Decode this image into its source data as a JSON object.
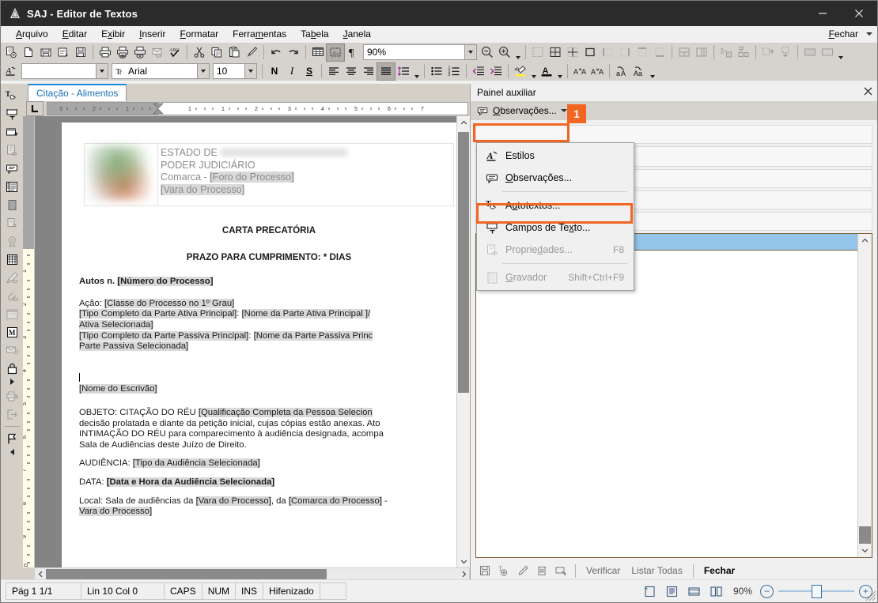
{
  "window": {
    "title": "SAJ - Editor de Textos",
    "icon": "app-icon",
    "minimize": "–",
    "close": "✕"
  },
  "menubar": {
    "items": [
      {
        "label": "Arquivo",
        "accel": "A"
      },
      {
        "label": "Editar",
        "accel": "E"
      },
      {
        "label": "Exibir",
        "accel": "x"
      },
      {
        "label": "Inserir",
        "accel": "I"
      },
      {
        "label": "Formatar",
        "accel": "F"
      },
      {
        "label": "Ferramentas",
        "accel": "m"
      },
      {
        "label": "Tabela",
        "accel": "b"
      },
      {
        "label": "Janela",
        "accel": "J"
      }
    ],
    "close_label": "Fechar"
  },
  "toolbar": {
    "zoom_value": "90%",
    "style_value": "",
    "font_value": "Arial",
    "size_value": "10",
    "bold_label": "N",
    "italic_label": "I",
    "underline_label": "S"
  },
  "tabs": {
    "active": "Citação - Alimentos"
  },
  "ruler": {
    "marks_left": [
      "3",
      "2",
      "1"
    ],
    "marks_right": [
      "1",
      "1",
      "2",
      "3",
      "4",
      "5",
      "6",
      "7"
    ]
  },
  "document": {
    "header": {
      "line1_prefix": "ESTADO DE",
      "line1_redacted": "",
      "line2": "PODER JUDICIÁRIO",
      "line3_prefix": "Comarca - ",
      "line3_field": "[Foro do Processo]",
      "line4_field": "[Vara do Processo]"
    },
    "title": "CARTA PRECATÓRIA",
    "subtitle": "PRAZO PARA CUMPRIMENTO: * DIAS",
    "autos_label": "Autos n. ",
    "autos_field": "[Número do Processo]",
    "acao_label": "Ação: ",
    "acao_field": "[Classe do Processo no 1º Grau]",
    "parte_ativa_tipo": "[Tipo Completo da Parte Ativa Principal]",
    "parte_ativa_nome": "[Nome da Parte Ativa Principal ]/",
    "parte_ativa_sel": "Ativa Selecionada]",
    "parte_passiva_tipo": "[Tipo Completo da Parte Passiva Principal]",
    "parte_passiva_nome": "[Nome da Parte Passiva Princ",
    "parte_passiva_sel": "Parte Passiva Selecionada]",
    "escrivao_field": "[Nome do Escrivão]",
    "objeto_label": "OBJETO: CITAÇÃO DO RÉU ",
    "objeto_field": "[Qualificação Completa da Pessoa Selecion",
    "objeto_line2": "decisão prolatada e diante da petição inicial, cujas cópias estão anexas. Ato",
    "objeto_line3": "INTIMAÇÃO DO RÉU para comparecimento à audiência designada, acompa",
    "objeto_line4": "Sala de Audiências deste Juízo de Direito.",
    "audiencia_label": "AUDIÊNCIA: ",
    "audiencia_field": "[Tipo da Audiência Selecionada]",
    "data_label": "DATA: ",
    "data_field": "[Data e Hora da Audiência Selecionada]",
    "local_prefix": "Local: Sala de audiências da ",
    "local_vara": "[Vara do Processo]",
    "local_mid": ", da ",
    "local_comarca": "[Comarca do Processo]",
    "local_suffix": " -",
    "local_line2": "Vara do Processo]"
  },
  "panel": {
    "title": "Painel auxiliar",
    "close_icon": "✕",
    "menu_button": {
      "label": "Observações...",
      "accel": "O",
      "icon": "comment-icon"
    },
    "footer": {
      "buttons": [
        "save-icon",
        "add-text-field-icon",
        "edit-pencil-icon",
        "delete-trash-icon",
        "select-field-icon"
      ],
      "links": [
        "Verificar",
        "Listar Todas"
      ],
      "close_label": "Fechar"
    }
  },
  "dropdown": {
    "items": [
      {
        "label": "Estilos",
        "accel": "",
        "icon": "styles-icon",
        "shortcut": "",
        "disabled": false,
        "sep_after": false
      },
      {
        "label": "Observações...",
        "accel": "O",
        "icon": "comment-icon",
        "shortcut": "",
        "disabled": false,
        "sep_after": true
      },
      {
        "label": "Autotextos...",
        "accel": "u",
        "icon": "autotext-icon",
        "shortcut": "",
        "disabled": false,
        "sep_after": false
      },
      {
        "label": "Campos de Texto...",
        "accel": "x",
        "icon": "text-field-icon",
        "shortcut": "",
        "disabled": false,
        "sep_after": false,
        "highlighted": true
      },
      {
        "label": "Propriedades...",
        "accel": "d",
        "icon": "properties-icon",
        "shortcut": "F8",
        "disabled": true,
        "sep_after": true
      },
      {
        "label": "Gravador",
        "accel": "G",
        "icon": "recorder-icon",
        "shortcut": "Shift+Ctrl+F9",
        "disabled": true,
        "sep_after": false
      }
    ]
  },
  "annotations": {
    "badge_1": "1"
  },
  "statusbar": {
    "cells": [
      {
        "name": "page-cell",
        "text": "Pág 1   1/1"
      },
      {
        "name": "line-col-cell",
        "text": "Lin 10  Col 0"
      },
      {
        "name": "caps-cell",
        "text": "CAPS"
      },
      {
        "name": "num-cell",
        "text": "NUM"
      },
      {
        "name": "ins-cell",
        "text": "INS"
      },
      {
        "name": "hyphen-cell",
        "text": "Hifenizado"
      },
      {
        "name": "empty-cell",
        "text": ""
      }
    ],
    "zoom_label": "90%",
    "zoom_out": "−",
    "zoom_in": "+",
    "view_buttons": [
      "view-single-page-icon",
      "view-reading-icon",
      "view-web-icon",
      "view-two-page-icon"
    ]
  },
  "colors": {
    "accent_orange": "#f26522",
    "selection_blue": "#93c4ea",
    "tab_blue": "#1e8ad6",
    "field_grey": "#d9d9d9",
    "titlebar": "#2b2b2b"
  }
}
